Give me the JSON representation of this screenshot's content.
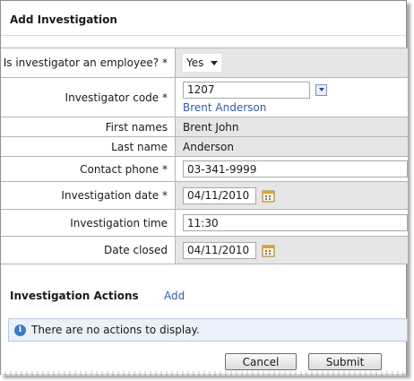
{
  "window": {
    "title": "Add Investigation"
  },
  "form": {
    "employee": {
      "label": "Is investigator an employee? *",
      "value": "Yes"
    },
    "code": {
      "label": "Investigator code *",
      "value": "1207",
      "lookup_name": "Brent Anderson"
    },
    "first_names": {
      "label": "First names",
      "value": "Brent John"
    },
    "last_name": {
      "label": "Last name",
      "value": "Anderson"
    },
    "phone": {
      "label": "Contact phone *",
      "value": "03-341-9999"
    },
    "inv_date": {
      "label": "Investigation date  *",
      "value": "04/11/2010"
    },
    "inv_time": {
      "label": "Investigation time",
      "value": "11:30"
    },
    "date_closed": {
      "label": "Date closed",
      "value": "04/11/2010"
    }
  },
  "actions": {
    "heading": "Investigation Actions",
    "add_label": "Add",
    "empty_message": "There are no actions to display."
  },
  "buttons": {
    "cancel": "Cancel",
    "submit": "Submit"
  },
  "icons": {
    "info": "info-icon",
    "calendar": "calendar-icon",
    "dropdown": "chevron-down-icon"
  },
  "colors": {
    "link": "#2f5fa7",
    "value_bg": "#e6e6e6",
    "info_bg": "#eaf1fb",
    "info_icon": "#3d79c9"
  }
}
